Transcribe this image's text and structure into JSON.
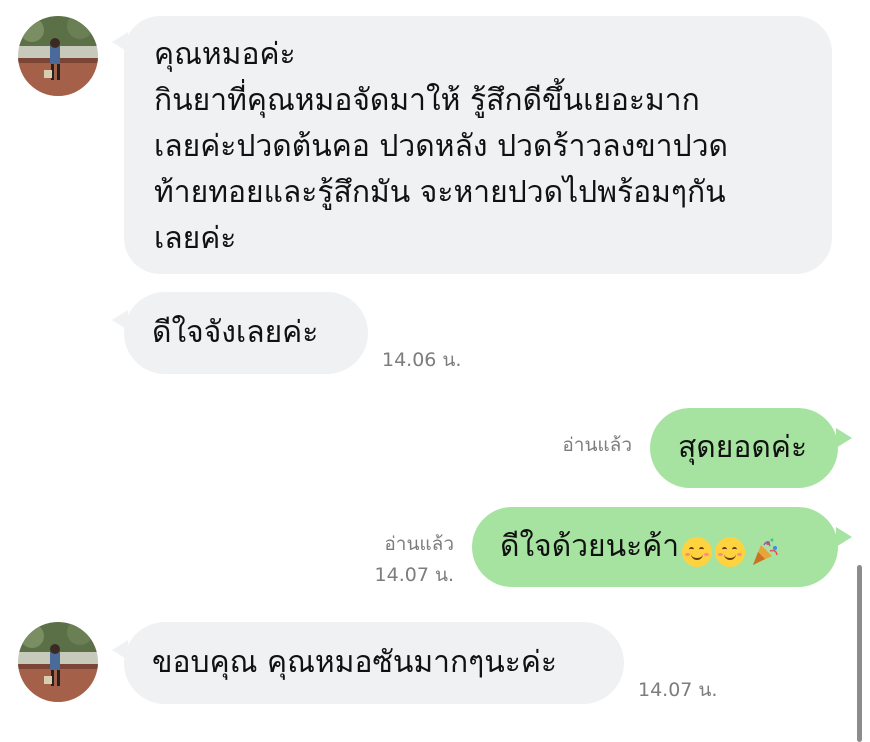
{
  "messages": [
    {
      "direction": "incoming",
      "text": "คุณหมอค่ะ\nกินยาที่คุณหมอจัดมาให้ รู้สึกดีขึ้นเยอะมาก\nเลยค่ะปวดต้นคอ ปวดหลัง ปวดร้าวลงขาปวด\nท้ายทอยและรู้สึกมัน จะหายปวดไปพร้อมๆกัน\nเลยค่ะ",
      "time": ""
    },
    {
      "direction": "incoming",
      "text": "ดีใจจังเลยค่ะ",
      "time": "14.06 น."
    },
    {
      "direction": "outgoing",
      "text": "สุดยอดค่ะ",
      "read": "อ่านแล้ว",
      "time": ""
    },
    {
      "direction": "outgoing",
      "text": "ดีใจด้วยนะค้า",
      "emojis": [
        "smiling-face-icon",
        "smiling-face-icon",
        "party-popper-icon"
      ],
      "read": "อ่านแล้ว",
      "time": "14.07 น."
    },
    {
      "direction": "incoming",
      "text": "ขอบคุณ คุณหมอซันมากๆนะค่ะ",
      "time": "14.07 น."
    }
  ],
  "colors": {
    "incoming_bubble": "#f0f1f2",
    "outgoing_bubble": "#a6e3a1",
    "meta_text": "#7d7d7d"
  }
}
